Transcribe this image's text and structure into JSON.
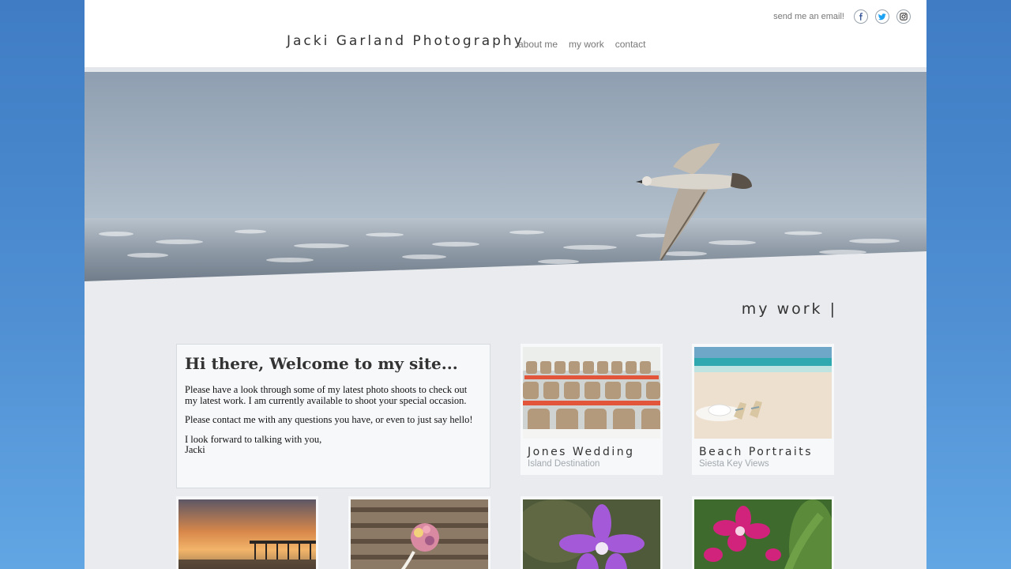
{
  "header": {
    "site_title": "Jacki Garland Photography",
    "nav": [
      "about me",
      "my work",
      "contact"
    ],
    "email_link": "send me an email!",
    "social": [
      {
        "name": "facebook-icon",
        "color": "#3b5998"
      },
      {
        "name": "twitter-icon",
        "color": "#1da1f2"
      },
      {
        "name": "instagram-icon",
        "color": "#333333"
      }
    ]
  },
  "hero": {
    "image": "seagull-flying-over-ocean"
  },
  "section": {
    "heading": "my work |"
  },
  "welcome": {
    "title": "Hi there, Welcome to my site...",
    "para1": "Please have a look through some of my latest photo shoots to check out my latest work. I am currently available to shoot your special occasion.",
    "para2": "Please contact me with any questions you have, or even to just say hello!",
    "para3_line1": "I look forward to talking with you,",
    "para3_line2": "Jacki"
  },
  "gallery": [
    {
      "title": "Jones Wedding",
      "subtitle": "Island Destination",
      "image": "wedding-reception-chairs"
    },
    {
      "title": "Beach Portraits",
      "subtitle": "Siesta Key Views",
      "image": "beach-hat-sandals"
    },
    {
      "image": "sunset-pier"
    },
    {
      "image": "bouquet-on-steps"
    },
    {
      "image": "purple-orchid"
    },
    {
      "image": "pink-orchids"
    }
  ]
}
